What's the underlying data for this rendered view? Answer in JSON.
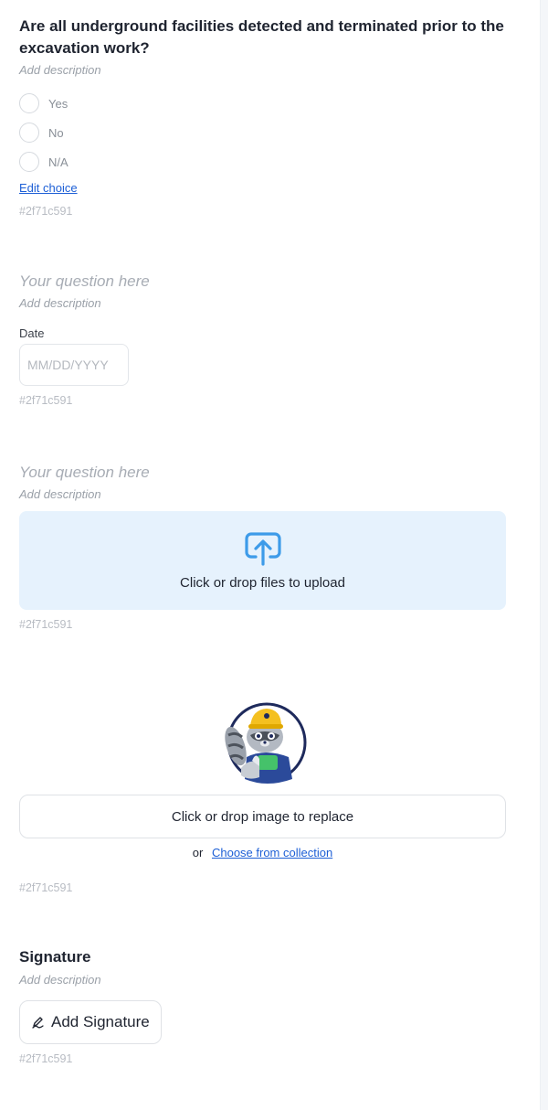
{
  "question1": {
    "title": "Are all underground facilities detected and terminated prior to the excavation work?",
    "description": "Add description",
    "choices": [
      "Yes",
      "No",
      "N/A"
    ],
    "edit_choice": "Edit choice",
    "id": "#2f71c591"
  },
  "question2": {
    "title": "Your question here",
    "description": "Add description",
    "field_label": "Date",
    "date_placeholder": "MM/DD/YYYY",
    "id": "#2f71c591"
  },
  "question3": {
    "title": "Your question here",
    "description": "Add description",
    "upload_text": "Click or drop files to upload",
    "upload_icon": "upload-icon",
    "id": "#2f71c591"
  },
  "image_block": {
    "replace_text": "Click or drop image to replace",
    "or_text": "or",
    "collection_link": "Choose from collection",
    "id": "#2f71c591"
  },
  "signature": {
    "title": "Signature",
    "description": "Add description",
    "button_label": "Add Signature",
    "button_icon": "pen-signature-icon",
    "id": "#2f71c591"
  },
  "colors": {
    "link": "#1d5fd6",
    "upload_bg": "#e6f2fd",
    "upload_icon": "#3d9be9",
    "mascot_ring": "#1e2a5c",
    "helmet": "#f4c020"
  }
}
